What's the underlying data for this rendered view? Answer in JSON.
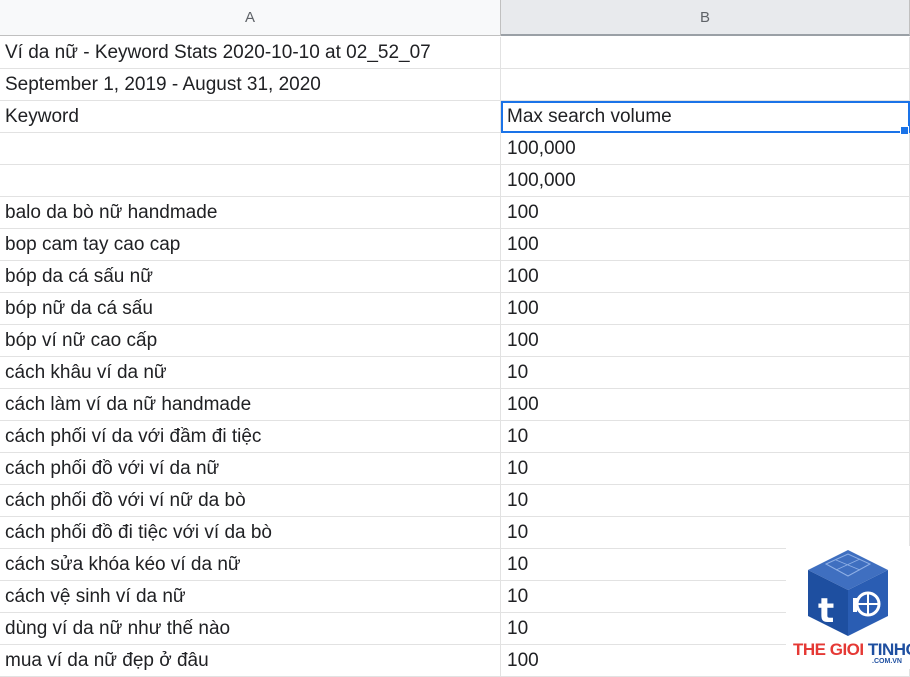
{
  "columns": {
    "a": "A",
    "b": "B"
  },
  "rows": [
    {
      "a": "Ví da nữ - Keyword Stats 2020-10-10 at 02_52_07",
      "b": ""
    },
    {
      "a": "September 1, 2019 - August 31, 2020",
      "b": ""
    },
    {
      "a": "Keyword",
      "b": "Max search volume"
    },
    {
      "a": "",
      "b": "100,000"
    },
    {
      "a": "",
      "b": "100,000"
    },
    {
      "a": "balo da bò nữ handmade",
      "b": "100"
    },
    {
      "a": "bop cam tay cao cap",
      "b": "100"
    },
    {
      "a": "bóp da cá sấu nữ",
      "b": "100"
    },
    {
      "a": "bóp nữ da cá sấu",
      "b": "100"
    },
    {
      "a": "bóp ví nữ cao cấp",
      "b": "100"
    },
    {
      "a": "cách khâu ví da nữ",
      "b": "10"
    },
    {
      "a": "cách làm ví da nữ handmade",
      "b": "100"
    },
    {
      "a": "cách phối ví da với đầm đi tiệc",
      "b": "10"
    },
    {
      "a": "cách phối đồ với ví da nữ",
      "b": "10"
    },
    {
      "a": "cách phối đồ với ví nữ da bò",
      "b": "10"
    },
    {
      "a": "cách phối đồ đi tiệc với ví da bò",
      "b": "10"
    },
    {
      "a": "cách sửa khóa kéo ví da nữ",
      "b": "10"
    },
    {
      "a": "cách vệ sinh ví da nữ",
      "b": "10"
    },
    {
      "a": "dùng ví da nữ như thế nào",
      "b": "10"
    },
    {
      "a": "mua ví da nữ đẹp ở đâu",
      "b": "100"
    }
  ],
  "selected_cell": "B3",
  "watermark": {
    "part1": "THE GIOI ",
    "part2": "TINHOC",
    "sub": ".COM.VN"
  },
  "colors": {
    "selection": "#1a73e8",
    "header_bg": "#f8f9fa",
    "logo_blue": "#1e4fa0",
    "logo_red": "#e53935"
  }
}
